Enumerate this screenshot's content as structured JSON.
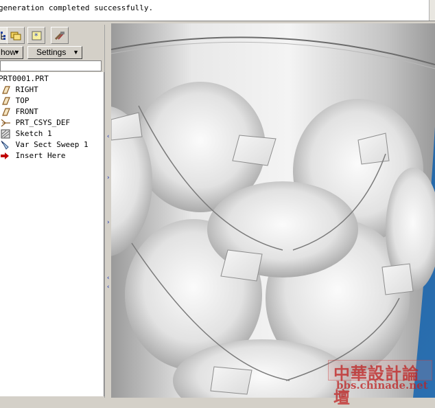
{
  "message_bar": {
    "text": "generation completed successfully."
  },
  "left_panel": {
    "tabs": [
      {
        "name": "model-tree-tab",
        "icon": "tree-icon"
      },
      {
        "name": "folder-browser-tab",
        "icon": "folders-icon"
      },
      {
        "name": "favorites-tab",
        "icon": "star-page-icon"
      },
      {
        "name": "connections-tab",
        "icon": "tools-icon"
      }
    ],
    "toolbar": {
      "show_label": "how",
      "settings_label": "Settings"
    },
    "tree": [
      {
        "label": "PRT0001.PRT",
        "icon": "part-icon"
      },
      {
        "label": "RIGHT",
        "icon": "datum-plane-icon"
      },
      {
        "label": "TOP",
        "icon": "datum-plane-icon"
      },
      {
        "label": "FRONT",
        "icon": "datum-plane-icon"
      },
      {
        "label": "PRT_CSYS_DEF",
        "icon": "coordinate-system-icon"
      },
      {
        "label": "Sketch 1",
        "icon": "sketch-icon"
      },
      {
        "label": "Var Sect Sweep 1",
        "icon": "sweep-icon"
      },
      {
        "label": "Insert Here",
        "icon": "insert-arrow-icon"
      }
    ]
  },
  "watermark": {
    "line1": "中華設計論壇",
    "line2": "bbs.chinade.net"
  },
  "colors": {
    "panel_bg": "#d4d0c8",
    "insert_arrow": "#c00000",
    "datum_plane": "#8a5a20",
    "watermark": "#c02020",
    "viewport_blue": "#2a6fb0"
  }
}
